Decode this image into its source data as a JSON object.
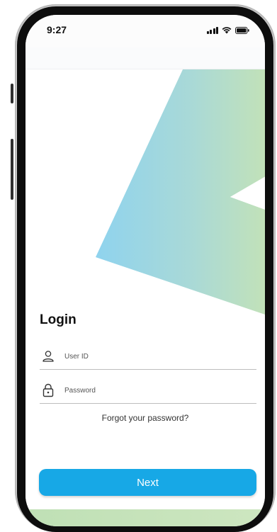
{
  "status_bar": {
    "time": "9:27",
    "icons": [
      "cellular-signal-icon",
      "wifi-icon",
      "battery-icon"
    ]
  },
  "login": {
    "title": "Login",
    "user_id": {
      "placeholder": "User ID",
      "value": "",
      "icon": "user-icon"
    },
    "password": {
      "placeholder": "Password",
      "value": "",
      "icon": "lock-icon"
    },
    "forgot_label": "Forgot your password?",
    "next_label": "Next"
  },
  "colors": {
    "primary_button": "#17a8e6",
    "brand_gradient_start": "#8fd3ee",
    "brand_gradient_end": "#bfe0b5"
  }
}
